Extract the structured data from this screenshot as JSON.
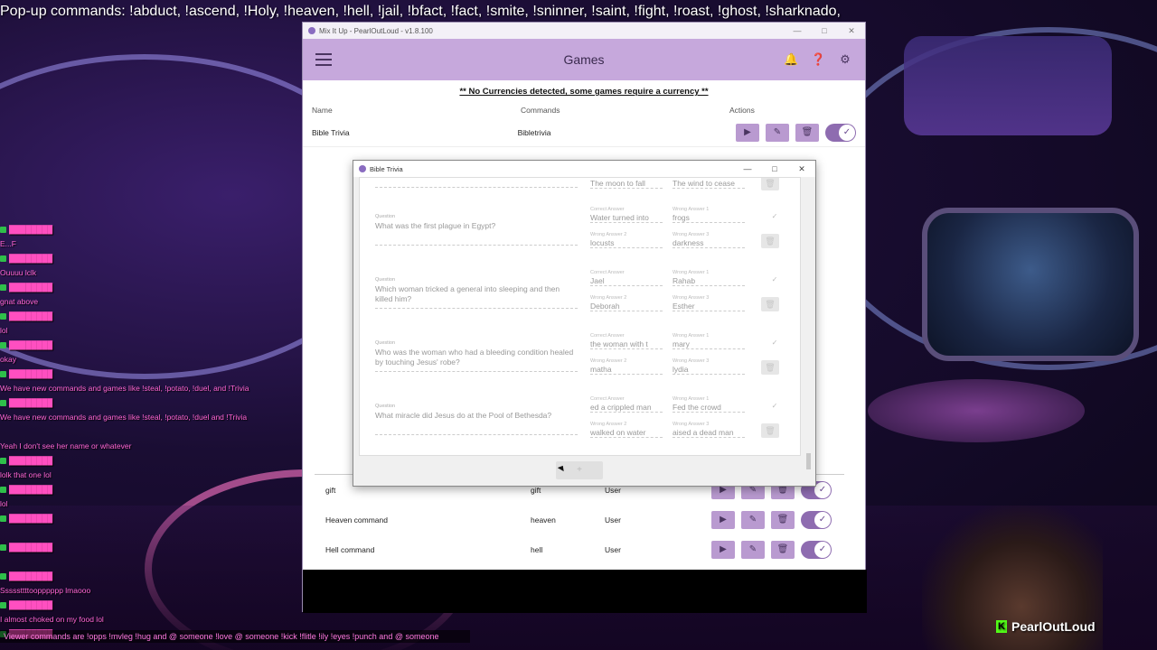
{
  "ticker": "Pop-up commands: !abduct, !ascend, !Holy, !heaven, !hell,  !jail, !bfact, !fact, !smite, !sninner, !saint, !fight, !roast, !ghost, !sharknado,",
  "chat": [
    {
      "who": "████████",
      "txt": ""
    },
    {
      "who": "",
      "txt": "E...F"
    },
    {
      "who": "████████",
      "txt": ""
    },
    {
      "who": "",
      "txt": "Ouuuu lclk"
    },
    {
      "who": "████████",
      "txt": ""
    },
    {
      "who": "",
      "txt": "gnat above"
    },
    {
      "who": "████████",
      "txt": ""
    },
    {
      "who": "",
      "txt": "lol"
    },
    {
      "who": "████████",
      "txt": ""
    },
    {
      "who": "",
      "txt": "okay"
    },
    {
      "who": "████████",
      "txt": ""
    },
    {
      "who": "",
      "txt": "We have new commands and games like !steal, !potato, !duel, and !Trivia"
    },
    {
      "who": "████████",
      "txt": ""
    },
    {
      "who": "",
      "txt": "We have new commands and games like !steal, !potato, !duel and !Trivia"
    },
    {
      "who": "",
      "txt": ""
    },
    {
      "who": "",
      "txt": "Yeah I don't see her name or whatever"
    },
    {
      "who": "████████",
      "txt": ""
    },
    {
      "who": "",
      "txt": "lolk that one lol"
    },
    {
      "who": "████████",
      "txt": ""
    },
    {
      "who": "",
      "txt": "lol"
    },
    {
      "who": "████████",
      "txt": ""
    },
    {
      "who": "",
      "txt": ""
    },
    {
      "who": "████████",
      "txt": ""
    },
    {
      "who": "",
      "txt": ""
    },
    {
      "who": "████████",
      "txt": ""
    },
    {
      "who": "",
      "txt": "Sssssttttoopppppp lmaooo"
    },
    {
      "who": "████████",
      "txt": ""
    },
    {
      "who": "",
      "txt": "I almost choked on my food lol"
    },
    {
      "who": "████████",
      "txt": ""
    }
  ],
  "bottom_ticker": "Viewer commands are !opps !mvleg !hug and @ someone !love @ someone !kick !flitle !ily !eyes !punch and @ someone",
  "brand": {
    "name": "PearlOutLoud",
    "logo_letter": "K"
  },
  "app": {
    "window_title": "Mix It Up - PearlOutLoud - v1.8.100",
    "page_title": "Games",
    "notice": "** No Currencies detected, some games require a currency **",
    "columns": {
      "name": "Name",
      "commands": "Commands",
      "actions": "Actions"
    },
    "top_game": {
      "name": "Bible Trivia",
      "command": "Bibletrivia"
    },
    "lower_rows": [
      {
        "name": "gift",
        "command": "gift",
        "permission": "User"
      },
      {
        "name": "Heaven command",
        "command": "heaven",
        "permission": "User"
      },
      {
        "name": "Hell command",
        "command": "hell",
        "permission": "User"
      }
    ]
  },
  "dialog": {
    "title": "Bible Trivia",
    "labels": {
      "question": "Question",
      "correct": "Correct Answer",
      "wrong1": "Wrong Answer 1",
      "wrong2": "Wrong Answer 2",
      "wrong3": "Wrong Answer 3"
    },
    "partial_row": {
      "wrong2": "The moon to fall",
      "wrong3": "The wind to cease"
    },
    "questions": [
      {
        "question": "What was the first plague in Egypt?",
        "correct": "Water turned into",
        "wrong1": "frogs",
        "wrong2": "locusts",
        "wrong3": "darkness"
      },
      {
        "question": "Which woman tricked a general into sleeping and then killed him?",
        "correct": "Jael",
        "wrong1": "Rahab",
        "wrong2": "Deborah",
        "wrong3": "Esther"
      },
      {
        "question": "Who was the woman who had a bleeding condition healed by touching Jesus' robe?",
        "correct": "the woman with t",
        "wrong1": "mary",
        "wrong2": "matha",
        "wrong3": "lydia"
      },
      {
        "question": "What miracle did Jesus do at the Pool of Bethesda?",
        "correct": "ed a crippled man",
        "wrong1": "Fed the crowd",
        "wrong2": "walked on water",
        "wrong3": "aised a dead man"
      }
    ]
  },
  "icons": {
    "menu": "hamburger-icon",
    "bell": "bell-icon",
    "help": "help-icon",
    "settings": "gear-icon",
    "play": "play-icon",
    "edit": "edit-icon",
    "delete": "trash-icon",
    "check": "check-icon"
  },
  "colors": {
    "header": "#c6a8dc",
    "button": "#b99ad0",
    "toggle": "#8e6cb0",
    "chat_text": "#ff66d6"
  }
}
